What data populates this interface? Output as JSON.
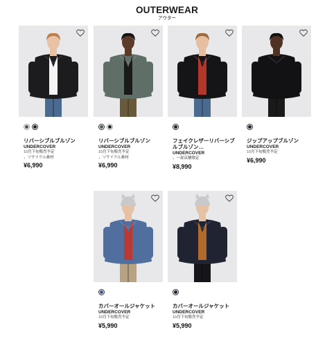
{
  "header": {
    "title": "OUTERWEAR",
    "subtitle": "アウター"
  },
  "products": [
    {
      "name": "リバーシブルブルゾン",
      "brand": "UNDERCOVER",
      "notes": [
        "10月下旬販売予定",
        "，リサイクル素材"
      ],
      "price": "¥6,990",
      "swatches": [
        {
          "color": "#44554a",
          "selected": false
        },
        {
          "color": "#1d1f2c",
          "selected": true
        }
      ],
      "photo": {
        "bg": "#e8e8ea",
        "jacket": "#1c1c1e",
        "inner": "#f4f4f4",
        "pants": "#4b6a8f",
        "skin": "#e9c2a6",
        "hair": "#b9814f"
      }
    },
    {
      "name": "リバーシブルブルゾン",
      "brand": "UNDERCOVER",
      "notes": [
        "10月下旬販売予定",
        "，リサイクル素材"
      ],
      "price": "¥6,990",
      "swatches": [
        {
          "color": "#4c5e57",
          "selected": true
        },
        {
          "color": "#1d1f2c",
          "selected": false
        }
      ],
      "photo": {
        "bg": "#e8e8ea",
        "jacket": "#5f6f67",
        "inner": "#1a1a1a",
        "pants": "#6a5a3c",
        "skin": "#5b3b2a",
        "hair": "#151515"
      }
    },
    {
      "name": "フェイクレザーリバーシブルブルゾン…",
      "brand": "UNDERCOVER",
      "notes": [
        "，一部店舗限定"
      ],
      "price": "¥8,990",
      "swatches": [
        {
          "color": "#1d1f2c",
          "selected": true
        }
      ],
      "photo": {
        "bg": "#e8e8ea",
        "jacket": "#151517",
        "inner": "#b2372b",
        "pants": "#4b6a8f",
        "skin": "#e6bfa1",
        "hair": "#9c6b42"
      }
    },
    {
      "name": "ジップアップブルゾン",
      "brand": "UNDERCOVER",
      "notes": [
        "10月下旬販売予定"
      ],
      "price": "¥6,990",
      "swatches": [
        {
          "color": "#1d1f2c",
          "selected": true
        }
      ],
      "photo": {
        "bg": "#e8e8ea",
        "jacket": "#121214",
        "inner": "#121214",
        "pants": "#1a1a1a",
        "skin": "#4f3223",
        "hair": "#121212"
      }
    },
    {
      "name": "カバーオールジャケット",
      "brand": "UNDERCOVER",
      "notes": [
        "10月下旬販売予定"
      ],
      "price": "¥5,990",
      "swatches": [
        {
          "color": "#3c4f80",
          "selected": true
        }
      ],
      "photo": {
        "bg": "#e8e8ea",
        "jacket": "#506f9e",
        "inner": "#b83a32",
        "pants": "#b7a283",
        "skin": "#e6c2a4",
        "hair": "#c9c9cb"
      }
    },
    {
      "name": "カバーオールジャケット",
      "brand": "UNDERCOVER",
      "notes": [
        "10月下旬販売予定"
      ],
      "price": "¥5,990",
      "swatches": [
        {
          "color": "#1d1f2c",
          "selected": true
        }
      ],
      "photo": {
        "bg": "#e8e8ea",
        "jacket": "#202331",
        "inner": "#b26a2c",
        "pants": "#16161a",
        "skin": "#e6c2a4",
        "hair": "#c9c9cb"
      }
    }
  ]
}
